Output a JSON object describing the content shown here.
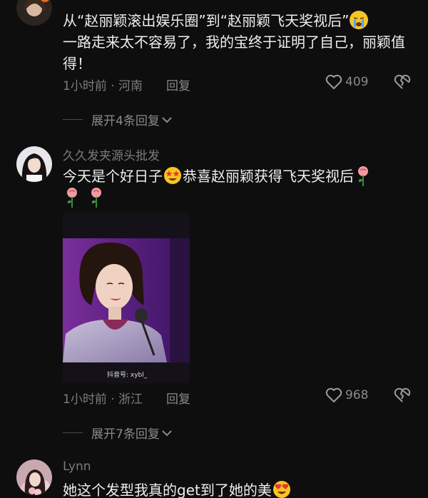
{
  "comments": [
    {
      "text": "从“赵丽颖滚出娱乐圈”到“赵丽颖飞天奖视后”",
      "text2": "一路走来太不容易了，我的宝终于证明了自己，丽颖值得！",
      "time_location": "1小时前 · 河南",
      "reply_label": "回复",
      "likes": "409",
      "expand_label": "展开4条回复"
    },
    {
      "username": "久久发夹源头批发",
      "text_a": "今天是个好日子",
      "text_b": "恭喜赵丽颖获得飞天奖视后",
      "photo_watermark": "抖音号: xybl_",
      "time_location": "1小时前 · 浙江",
      "reply_label": "回复",
      "likes": "968",
      "expand_label": "展开7条回复"
    },
    {
      "username": "Lynn",
      "text": "她这个发型我真的get到了她的美"
    }
  ],
  "icons": {
    "heart": "heart-outline-icon",
    "dislike": "broken-heart-icon",
    "chevron": "chevron-down-icon",
    "cry_emoji": "crying-face-emoji",
    "star_emoji": "star-struck-emoji",
    "heart_eyes_emoji": "heart-eyes-emoji",
    "rose": "rose-emoji"
  }
}
